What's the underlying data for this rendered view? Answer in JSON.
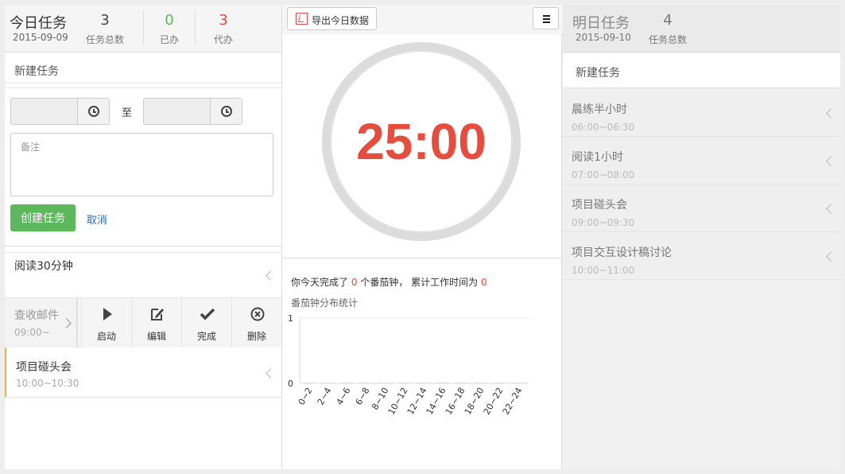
{
  "today": {
    "title": "今日任务",
    "date": "2015-09-09",
    "stats": [
      {
        "value": "3",
        "label": "任务总数",
        "color": "#444444"
      },
      {
        "value": "0",
        "label": "已办",
        "color": "#5cb85c"
      },
      {
        "value": "3",
        "label": "代办",
        "color": "#e74c3c"
      }
    ],
    "new_task_label": "新建任务",
    "form": {
      "to_label": "至",
      "start_time": "",
      "end_time": "",
      "note_placeholder": "备注",
      "create_label": "创建任务",
      "cancel_label": "取消"
    },
    "tasks": [
      {
        "name": "阅读30分钟",
        "time": ""
      },
      {
        "name": "查收邮件",
        "time": "09:00~"
      },
      {
        "name": "项目碰头会",
        "time": "10:00~10:30"
      }
    ],
    "actions": [
      {
        "label": "启动",
        "icon": "play-icon"
      },
      {
        "label": "编辑",
        "icon": "edit-icon"
      },
      {
        "label": "完成",
        "icon": "check-icon"
      },
      {
        "label": "删除",
        "icon": "delete-icon"
      }
    ]
  },
  "middle": {
    "export_label": "导出今日数据",
    "timer": "25:00",
    "summary": {
      "prefix": "你今天完成了",
      "pomodoros": "0",
      "middle": "个番茄钟，  累计工作时间为",
      "work_time": "0"
    },
    "chart_title": "番茄钟分布统计",
    "accent_color": "#e74c3c"
  },
  "chart_data": {
    "type": "bar",
    "title": "番茄钟分布统计",
    "categories": [
      "0~2",
      "2~4",
      "4~6",
      "6~8",
      "8~10",
      "10~12",
      "12~14",
      "14~16",
      "16~18",
      "18~20",
      "20~22",
      "22~24"
    ],
    "values": [
      0,
      0,
      0,
      0,
      0,
      0,
      0,
      0,
      0,
      0,
      0,
      0
    ],
    "ylim": [
      0,
      1
    ],
    "yticks": [
      "1",
      "0"
    ],
    "grid": true
  },
  "tomorrow": {
    "title": "明日任务",
    "date": "2015-09-10",
    "count": "4",
    "count_label": "任务总数",
    "new_task_label": "新建任务",
    "tasks": [
      {
        "name": "晨练半小时",
        "time": "06:00~06:30"
      },
      {
        "name": "阅读1小时",
        "time": "07:00~08:00"
      },
      {
        "name": "项目碰头会",
        "time": "09:00~09:30"
      },
      {
        "name": "项目交互设计稿讨论",
        "time": "10:00~11:00"
      }
    ]
  }
}
